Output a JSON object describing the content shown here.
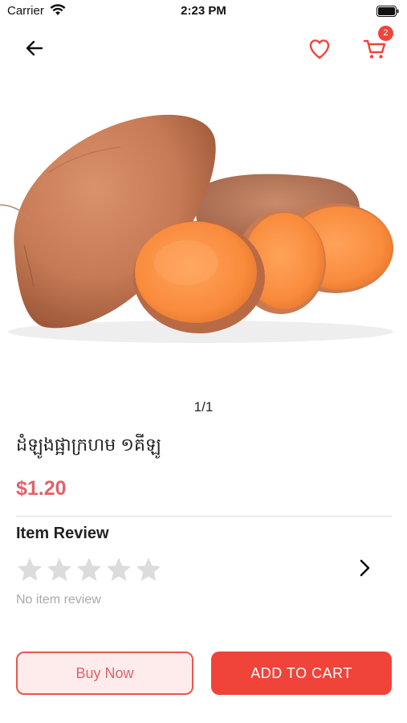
{
  "status_bar": {
    "carrier": "Carrier",
    "time": "2:23 PM",
    "icons": [
      "wifi-icon",
      "battery-icon"
    ]
  },
  "nav": {
    "back_icon": "arrow-left-icon",
    "favorite_icon": "heart-icon",
    "cart_icon": "cart-icon",
    "cart_badge": "2"
  },
  "product": {
    "image_alt": "sweet-potato",
    "image_counter": "1/1",
    "name": "ដំឡូងផ្អាក្រហម ១គីឡូ",
    "price": "$1.20"
  },
  "review": {
    "title": "Item Review",
    "rating": 0,
    "max_rating": 5,
    "empty_text": "No item review",
    "chevron_icon": "chevron-right-icon"
  },
  "actions": {
    "buy_now": "Buy Now",
    "add_to_cart": "ADD TO CART"
  },
  "colors": {
    "accent": "#f0433a",
    "price": "#e0636a",
    "star_empty": "#dcdcdc"
  }
}
